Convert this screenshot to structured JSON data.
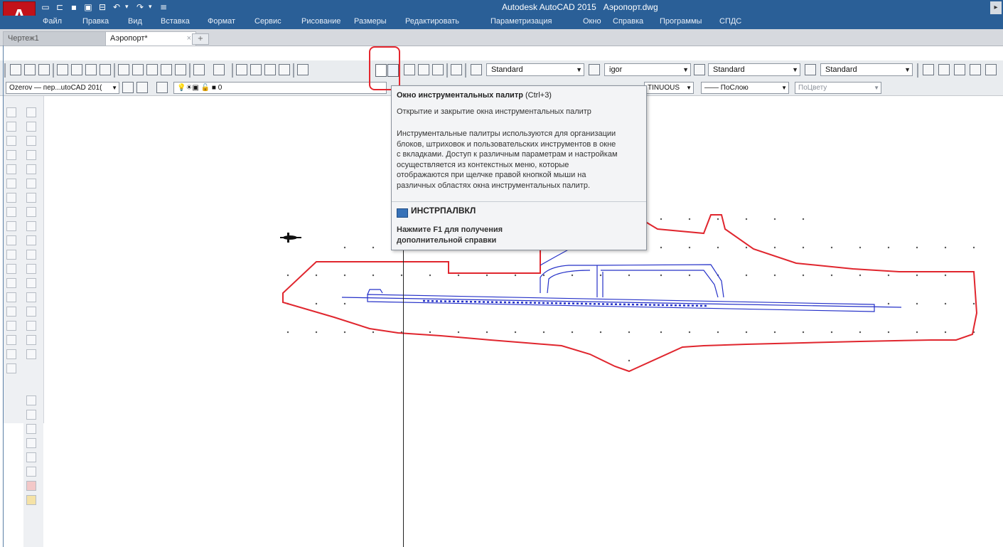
{
  "app": {
    "logo_letter": "A",
    "title": "Autodesk AutoCAD 2015",
    "filename": "Аэропорт.dwg",
    "brand_color": "#c2121a",
    "titlebar_color": "#2a5f97"
  },
  "menu": [
    "Файл",
    "Правка",
    "Вид",
    "Вставка",
    "Формат",
    "Сервис",
    "Рисование",
    "Размеры",
    "Редактировать",
    "Параметризация",
    "Окно",
    "Справка",
    "Программы",
    "СПДС"
  ],
  "tabs": [
    {
      "label": "Чертеж1",
      "active": false
    },
    {
      "label": "Аэропорт*",
      "active": true
    }
  ],
  "tab_close": "×",
  "tab_plus": "+",
  "toolbar": {
    "text_style": "Standard",
    "dim_style": "igor",
    "table_style": "Standard",
    "mleader_style": "Standard"
  },
  "layers": {
    "layer_combo": "Ozerov — пер...utoCAD 201(",
    "layer_name": "0",
    "linetype_combo": "TINUOUS",
    "lineweight_combo": "—— ПоСлою",
    "plotstyle_combo": "ПоЦвету"
  },
  "tooltip": {
    "title": "Окно инструментальных палитр",
    "shortcut": "(Ctrl+3)",
    "short_desc": "Открытие и закрытие окна инструментальных палитр",
    "desc_lines": [
      "Инструментальные палитры используются для организации",
      "блоков, штриховок и пользовательских инструментов в окне",
      "с вкладками. Доступ к различным параметрам и настройкам",
      "осуществляется из контекстных меню, которые",
      "отображаются при щелчке правой кнопкой мыши на",
      "различных областях окна инструментальных палитр."
    ],
    "command": "ИНСТРПАЛВКЛ",
    "help_line1": "Нажмите F1 для получения",
    "help_line2": "дополнительной справки"
  },
  "icons": {
    "highlighted_tool": "tool-palettes-icon",
    "command_icon": "tool-palette-command-icon"
  },
  "colors": {
    "highlight_border": "#e4262e",
    "boundary_line": "#e0262e",
    "runway_line": "#2430c8"
  }
}
